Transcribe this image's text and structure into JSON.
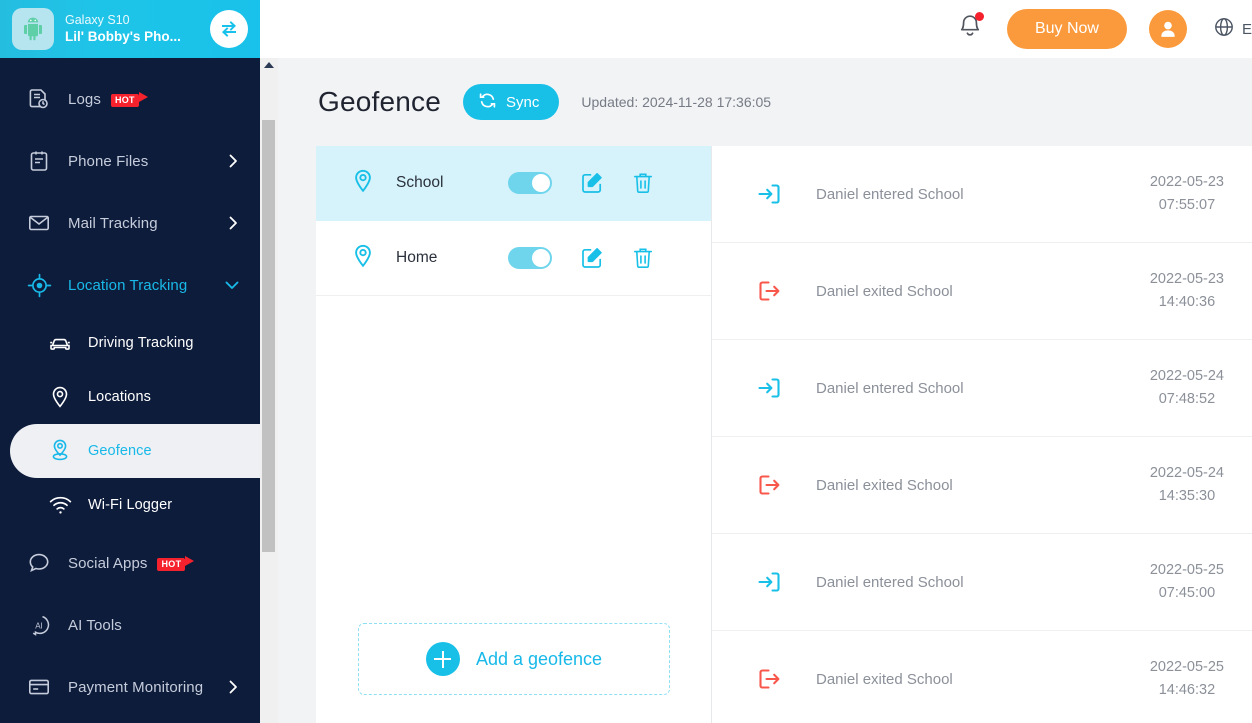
{
  "device": {
    "model": "Galaxy S10",
    "name": "Lil' Bobby's Pho...",
    "avatar_icon": "android-robot-icon",
    "switch_icon": "switch-device-icon"
  },
  "sidebar": {
    "items": [
      {
        "label": "Logs",
        "icon": "logs-icon",
        "badge": "HOT",
        "chevron": false,
        "type": "top"
      },
      {
        "label": "Phone Files",
        "icon": "phone-files-icon",
        "badge": "",
        "chevron": true,
        "type": "top"
      },
      {
        "label": "Mail Tracking",
        "icon": "mail-icon",
        "badge": "",
        "chevron": true,
        "type": "top"
      },
      {
        "label": "Location Tracking",
        "icon": "location-target-icon",
        "badge": "",
        "chevron": true,
        "type": "top",
        "expanded": true
      },
      {
        "label": "Driving Tracking",
        "icon": "car-icon",
        "badge": "",
        "chevron": false,
        "type": "sub"
      },
      {
        "label": "Locations",
        "icon": "map-pin-icon",
        "badge": "",
        "chevron": false,
        "type": "sub"
      },
      {
        "label": "Geofence",
        "icon": "geofence-pin-icon",
        "badge": "",
        "chevron": false,
        "type": "sub",
        "active": true
      },
      {
        "label": "Wi-Fi Logger",
        "icon": "wifi-icon",
        "badge": "",
        "chevron": false,
        "type": "sub"
      },
      {
        "label": "Social Apps",
        "icon": "chat-bubble-icon",
        "badge": "HOT",
        "chevron": false,
        "type": "top"
      },
      {
        "label": "AI Tools",
        "icon": "ai-icon",
        "badge": "",
        "chevron": false,
        "type": "top"
      },
      {
        "label": "Payment Monitoring",
        "icon": "credit-card-icon",
        "badge": "",
        "chevron": true,
        "type": "top"
      }
    ]
  },
  "topbar": {
    "notification_icon": "bell-icon",
    "has_notification_dot": true,
    "buy_now_label": "Buy Now",
    "account_icon": "user-avatar-icon",
    "language_icon": "globe-icon",
    "language_label": "E"
  },
  "main": {
    "title": "Geofence",
    "sync_label": "Sync",
    "sync_icon": "refresh-icon",
    "updated": "Updated: 2024-11-28 17:36:05"
  },
  "geofences": [
    {
      "name": "School",
      "enabled": true,
      "selected": true,
      "pin_icon": "map-pin-icon",
      "edit_icon": "edit-icon",
      "delete_icon": "trash-icon"
    },
    {
      "name": "Home",
      "enabled": true,
      "selected": false,
      "pin_icon": "map-pin-icon",
      "edit_icon": "edit-icon",
      "delete_icon": "trash-icon"
    }
  ],
  "add_geofence": {
    "label": "Add a geofence",
    "icon": "plus-circle-icon"
  },
  "events": [
    {
      "text": "Daniel entered School",
      "date": "2022-05-23",
      "time": "07:55:07",
      "type": "entered",
      "icon": "enter-arrow-icon"
    },
    {
      "text": "Daniel exited School",
      "date": "2022-05-23",
      "time": "14:40:36",
      "type": "exited",
      "icon": "exit-arrow-icon"
    },
    {
      "text": "Daniel entered School",
      "date": "2022-05-24",
      "time": "07:48:52",
      "type": "entered",
      "icon": "enter-arrow-icon"
    },
    {
      "text": "Daniel exited School",
      "date": "2022-05-24",
      "time": "14:35:30",
      "type": "exited",
      "icon": "exit-arrow-icon"
    },
    {
      "text": "Daniel entered School",
      "date": "2022-05-25",
      "time": "07:45:00",
      "type": "entered",
      "icon": "enter-arrow-icon"
    },
    {
      "text": "Daniel exited School",
      "date": "2022-05-25",
      "time": "14:46:32",
      "type": "exited",
      "icon": "exit-arrow-icon"
    }
  ],
  "colors": {
    "sidebar_bg": "#0e1c3b",
    "device_bar": "#19c2ea",
    "accent_cyan": "#18c0e8",
    "accent_orange": "#fb9a3c",
    "selected_row": "#d6f2fa",
    "enter_icon": "#18c0e8",
    "exit_icon": "#f8574b",
    "hot_badge": "#f5222d"
  }
}
